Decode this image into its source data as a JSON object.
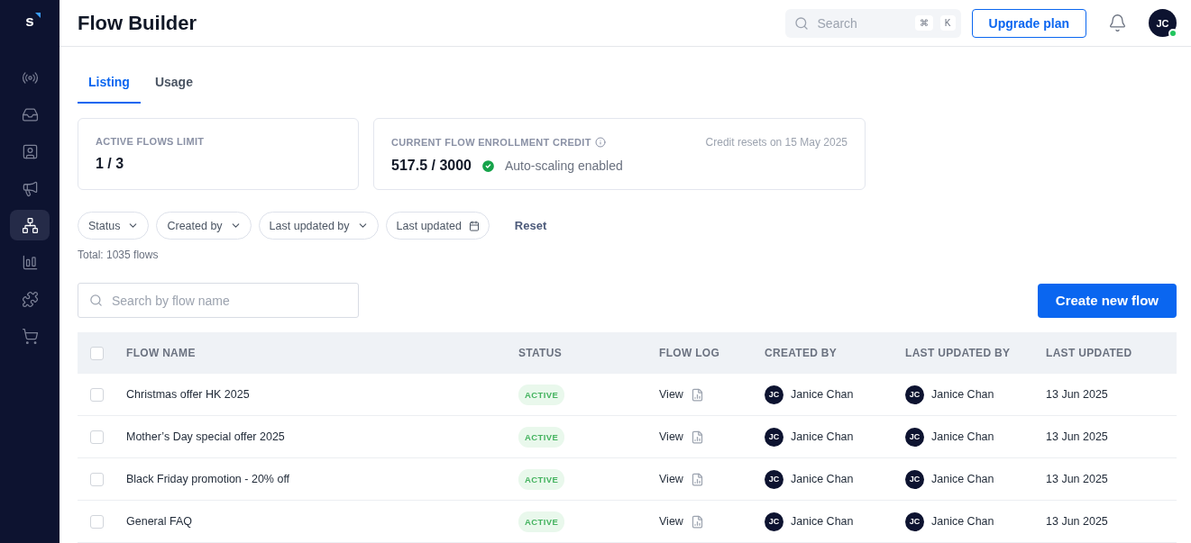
{
  "sidebar": {
    "logo": "s",
    "items": [
      {
        "selected": false
      },
      {
        "selected": false
      },
      {
        "selected": false
      },
      {
        "selected": false
      },
      {
        "selected": true
      },
      {
        "selected": false
      },
      {
        "selected": false
      },
      {
        "selected": false
      }
    ]
  },
  "header": {
    "title": "Flow Builder",
    "search": {
      "placeholder": "Search",
      "keys": [
        "⌘",
        "K"
      ]
    },
    "upgrade_button": "Upgrade plan",
    "avatar": {
      "initials": "JC",
      "online": true
    }
  },
  "tabs": [
    {
      "label": "Listing",
      "selected": true
    },
    {
      "label": "Usage",
      "selected": false
    }
  ],
  "cards": [
    {
      "label": "ACTIVE FLOWS LIMIT",
      "value": "1 / 3"
    },
    {
      "label": "CURRENT FLOW ENROLLMENT CREDIT",
      "value": "517.5 / 3000",
      "status": "Auto-scaling enabled",
      "note": "Credit resets on 15 May 2025"
    }
  ],
  "filters": [
    {
      "label": "Status",
      "kind": "dropdown"
    },
    {
      "label": "Created by",
      "kind": "dropdown"
    },
    {
      "label": "Last updated by",
      "kind": "dropdown"
    },
    {
      "label": "Last updated",
      "kind": "date"
    }
  ],
  "reset": "Reset",
  "total": "Total: 1035 flows",
  "flow_search": {
    "placeholder": "Search by flow name"
  },
  "create_button": "Create new flow",
  "table": {
    "columns": [
      "FLOW NAME",
      "STATUS",
      "FLOW LOG",
      "CREATED BY",
      "LAST UPDATED BY",
      "LAST UPDATED"
    ],
    "all_checked": false,
    "rows": [
      {
        "checked": false,
        "name": "Christmas offer HK 2025",
        "status": "ACTIVE",
        "log": "View",
        "created_by": {
          "initials": "JC",
          "name": "Janice Chan"
        },
        "updated_by": {
          "initials": "JC",
          "name": "Janice Chan"
        },
        "updated": "13 Jun 2025"
      },
      {
        "checked": false,
        "name": "Mother’s Day special offer 2025",
        "status": "ACTIVE",
        "log": "View",
        "created_by": {
          "initials": "JC",
          "name": "Janice Chan"
        },
        "updated_by": {
          "initials": "JC",
          "name": "Janice Chan"
        },
        "updated": "13 Jun 2025"
      },
      {
        "checked": false,
        "name": "Black Friday promotion - 20% off",
        "status": "ACTIVE",
        "log": "View",
        "created_by": {
          "initials": "JC",
          "name": "Janice Chan"
        },
        "updated_by": {
          "initials": "JC",
          "name": "Janice Chan"
        },
        "updated": "13 Jun 2025"
      },
      {
        "checked": false,
        "name": "General FAQ",
        "status": "ACTIVE",
        "log": "View",
        "created_by": {
          "initials": "JC",
          "name": "Janice Chan"
        },
        "updated_by": {
          "initials": "JC",
          "name": "Janice Chan"
        },
        "updated": "13 Jun 2025"
      }
    ]
  }
}
